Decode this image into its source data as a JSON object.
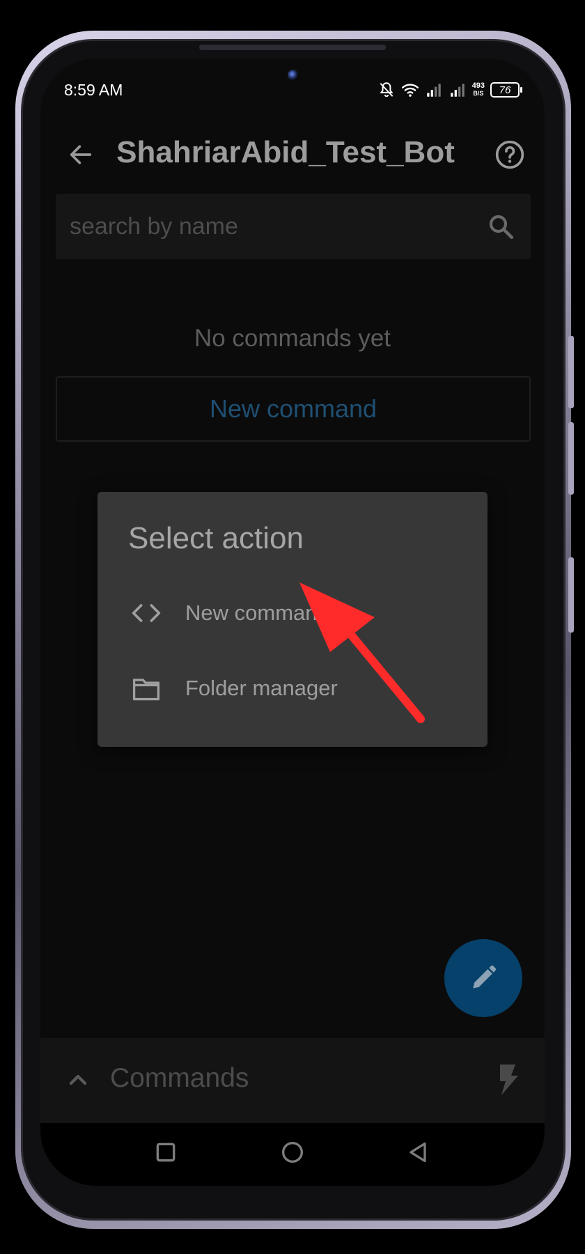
{
  "status_bar": {
    "time": "8:59 AM",
    "net_speed_value": "493",
    "net_speed_unit": "B/S",
    "battery": "76"
  },
  "app_bar": {
    "title": "ShahriarAbid_Test_Bot"
  },
  "search": {
    "placeholder": "search by name"
  },
  "main": {
    "empty_text": "No commands yet",
    "new_command_label": "New command"
  },
  "dialog": {
    "title": "Select action",
    "items": [
      {
        "label": "New command",
        "icon": "code-icon"
      },
      {
        "label": "Folder manager",
        "icon": "folder-icon"
      }
    ]
  },
  "bottom_bar": {
    "label": "Commands"
  },
  "colors": {
    "accent_text": "#1f4f72",
    "fab": "#06416b",
    "dialog_bg": "#373737",
    "annotation_arrow": "#ff2b2b"
  }
}
